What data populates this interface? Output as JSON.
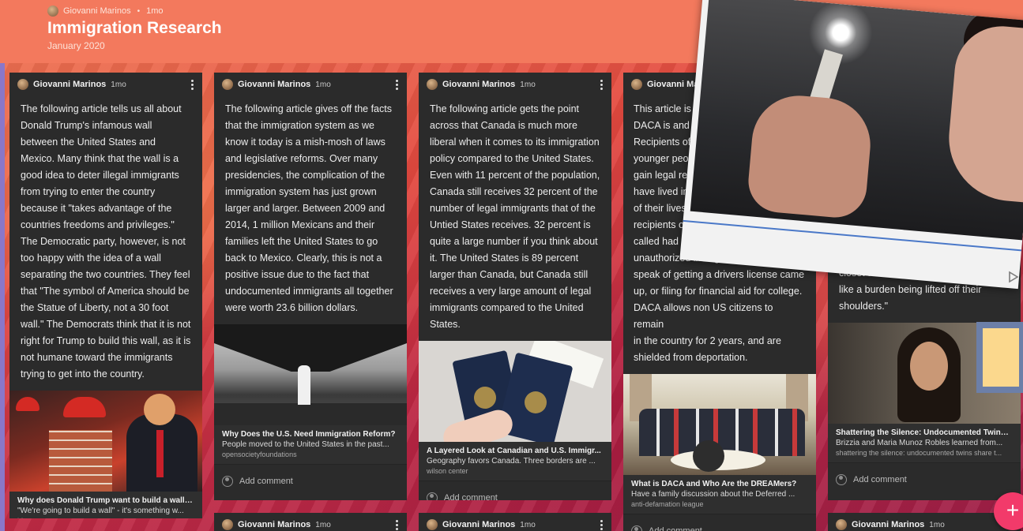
{
  "board": {
    "author": "Giovanni Marinos",
    "time": "1mo",
    "title": "Immigration Research",
    "subtitle": "January 2020"
  },
  "add_comment_label": "Add comment",
  "cards": [
    {
      "author": "Giovanni Marinos",
      "time": "1mo",
      "body": "The following article tells us all about Donald Trump's infamous wall between the United States and Mexico. Many think that the wall is a good idea to deter illegal immigrants from trying to enter the country because it \"takes advantage of the countries freedoms and privileges.\" The Democratic party, however, is not too happy with the idea of a wall separating the two countries. They feel that \"The symbol of America should be the Statue of Liberty, not a 30 foot wall.\" The Democrats think that it is not right for Trump to build this wall, as it is not humane toward the immigrants trying to get into the country.",
      "attachment_title": "Why does Donald Trump want to build a wall?...",
      "attachment_desc": "\"We're going to build a wall\" - it's something w...",
      "attachment_source": "bbc"
    },
    {
      "author": "Giovanni Marinos",
      "time": "1mo",
      "body": "The following article gives off the facts that the immigration system as we know it today is a mish-mosh of laws and legislative reforms. Over many presidencies, the complication of the immigration system has just grown larger and larger. Between 2009 and 2014, 1 million Mexicans and their families left the United States to go back to Mexico. Clearly, this is not a positive issue due to the fact that undocumented immigrants all together were worth 23.6 billion dollars.",
      "attachment_title": "Why Does the U.S. Need Immigration Reform?",
      "attachment_desc": "People moved to the United States in the past...",
      "attachment_source": "opensocietyfoundations"
    },
    {
      "author": "Giovanni Marinos",
      "time": "1mo",
      "body": "The following article gets the point across that Canada is much more liberal when it comes to its immigration policy compared to the United States. Even with 11 percent of the population, Canada still receives 32 percent of the number of legal immigrants that of the Untied States receives. 32 percent is quite a large number if you think about it. The United States is 89 percent larger than Canada, but Canada still receives a very large amount of legal immigrants compared to the United States.",
      "attachment_title": "A Layered Look at Canadian and U.S. Immigr...",
      "attachment_desc": "Geography favors Canada. Three borders are ...",
      "attachment_source": "wilson center"
    },
    {
      "author": "Giovanni Marinos",
      "time": "",
      "body_lines": [
        "This article is an e",
        "DACA is and who",
        "Recipients of DAC",
        "younger people w",
        "gain legal reside",
        "have lived in the",
        "of their lives. M",
        "recipients or D",
        "called had no c",
        "unauthorized immigrants until th",
        "speak of getting a drivers license came",
        "up, or filing for financial aid for college.",
        "DACA allows non US citizens to remain",
        "in the country for 2 years, and are",
        "shielded from deportation."
      ],
      "attachment_title": "What is DACA and Who Are the DREAMers?",
      "attachment_desc": "Have a family discussion about the Deferred ...",
      "attachment_source": "anti-defamation league"
    },
    {
      "body_lines": [
        "closet about th",
        "like a burden being lifted off their",
        "shoulders.\""
      ],
      "attachment_title": "Shattering the Silence: Undocumented Twins ...",
      "attachment_desc": "Brizzia and Maria Munoz Robles learned from...",
      "attachment_source": "shattering the silence: undocumented twins share t..."
    }
  ],
  "bottom_cards": [
    {
      "author": "Giovanni Marinos",
      "time": "1mo"
    },
    {
      "author": "Giovanni Marinos",
      "time": "1mo"
    },
    {
      "author": "Giovanni Marinos",
      "time": "1mo"
    }
  ],
  "fab_label": "+"
}
